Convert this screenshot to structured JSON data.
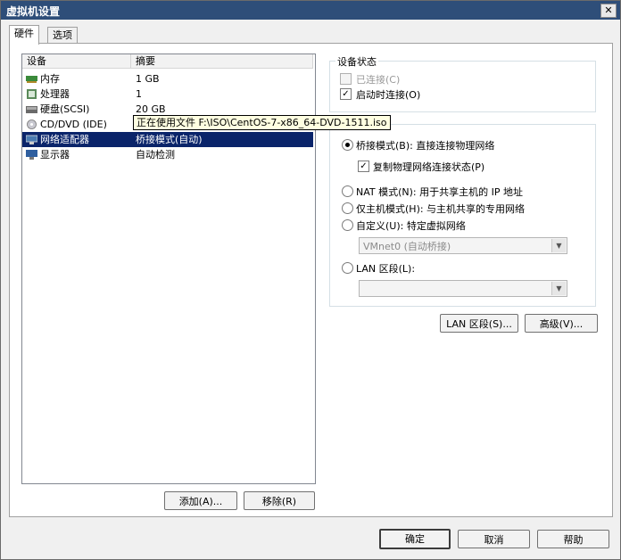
{
  "window": {
    "title": "虚拟机设置",
    "close": "✕"
  },
  "tabs": [
    {
      "label": "硬件"
    },
    {
      "label": "选项"
    }
  ],
  "devices": {
    "col_device": "设备",
    "col_summary": "摘要",
    "items": [
      {
        "name": "内存",
        "summary": "1 GB",
        "icon": "memory-icon"
      },
      {
        "name": "处理器",
        "summary": "1",
        "icon": "cpu-icon"
      },
      {
        "name": "硬盘(SCSI)",
        "summary": "20 GB",
        "icon": "harddisk-icon"
      },
      {
        "name": "CD/DVD (IDE)",
        "summary": "",
        "icon": "cdrom-icon"
      },
      {
        "name": "网络适配器",
        "summary": "桥接模式(自动)",
        "icon": "network-adapter-icon"
      },
      {
        "name": "显示器",
        "summary": "自动检测",
        "icon": "display-icon"
      }
    ],
    "tooltip": "正在使用文件 F:\\ISO\\CentOS-7-x86_64-DVD-1511.iso"
  },
  "buttons": {
    "add": "添加(A)...",
    "remove": "移除(R)",
    "lan_segment": "LAN 区段(S)...",
    "advanced": "高级(V)...",
    "ok": "确定",
    "cancel": "取消",
    "help": "帮助"
  },
  "device_status": {
    "title": "设备状态",
    "connected": "已连接(C)",
    "connect_at_power_on": "启动时连接(O)"
  },
  "network": {
    "bridged": "桥接模式(B): 直接连接物理网络",
    "replicate": "复制物理网络连接状态(P)",
    "nat": "NAT 模式(N): 用于共享主机的 IP 地址",
    "host_only": "仅主机模式(H): 与主机共享的专用网络",
    "custom": "自定义(U): 特定虚拟网络",
    "custom_value": "VMnet0 (自动桥接)",
    "lan": "LAN 区段(L):",
    "lan_value": ""
  }
}
